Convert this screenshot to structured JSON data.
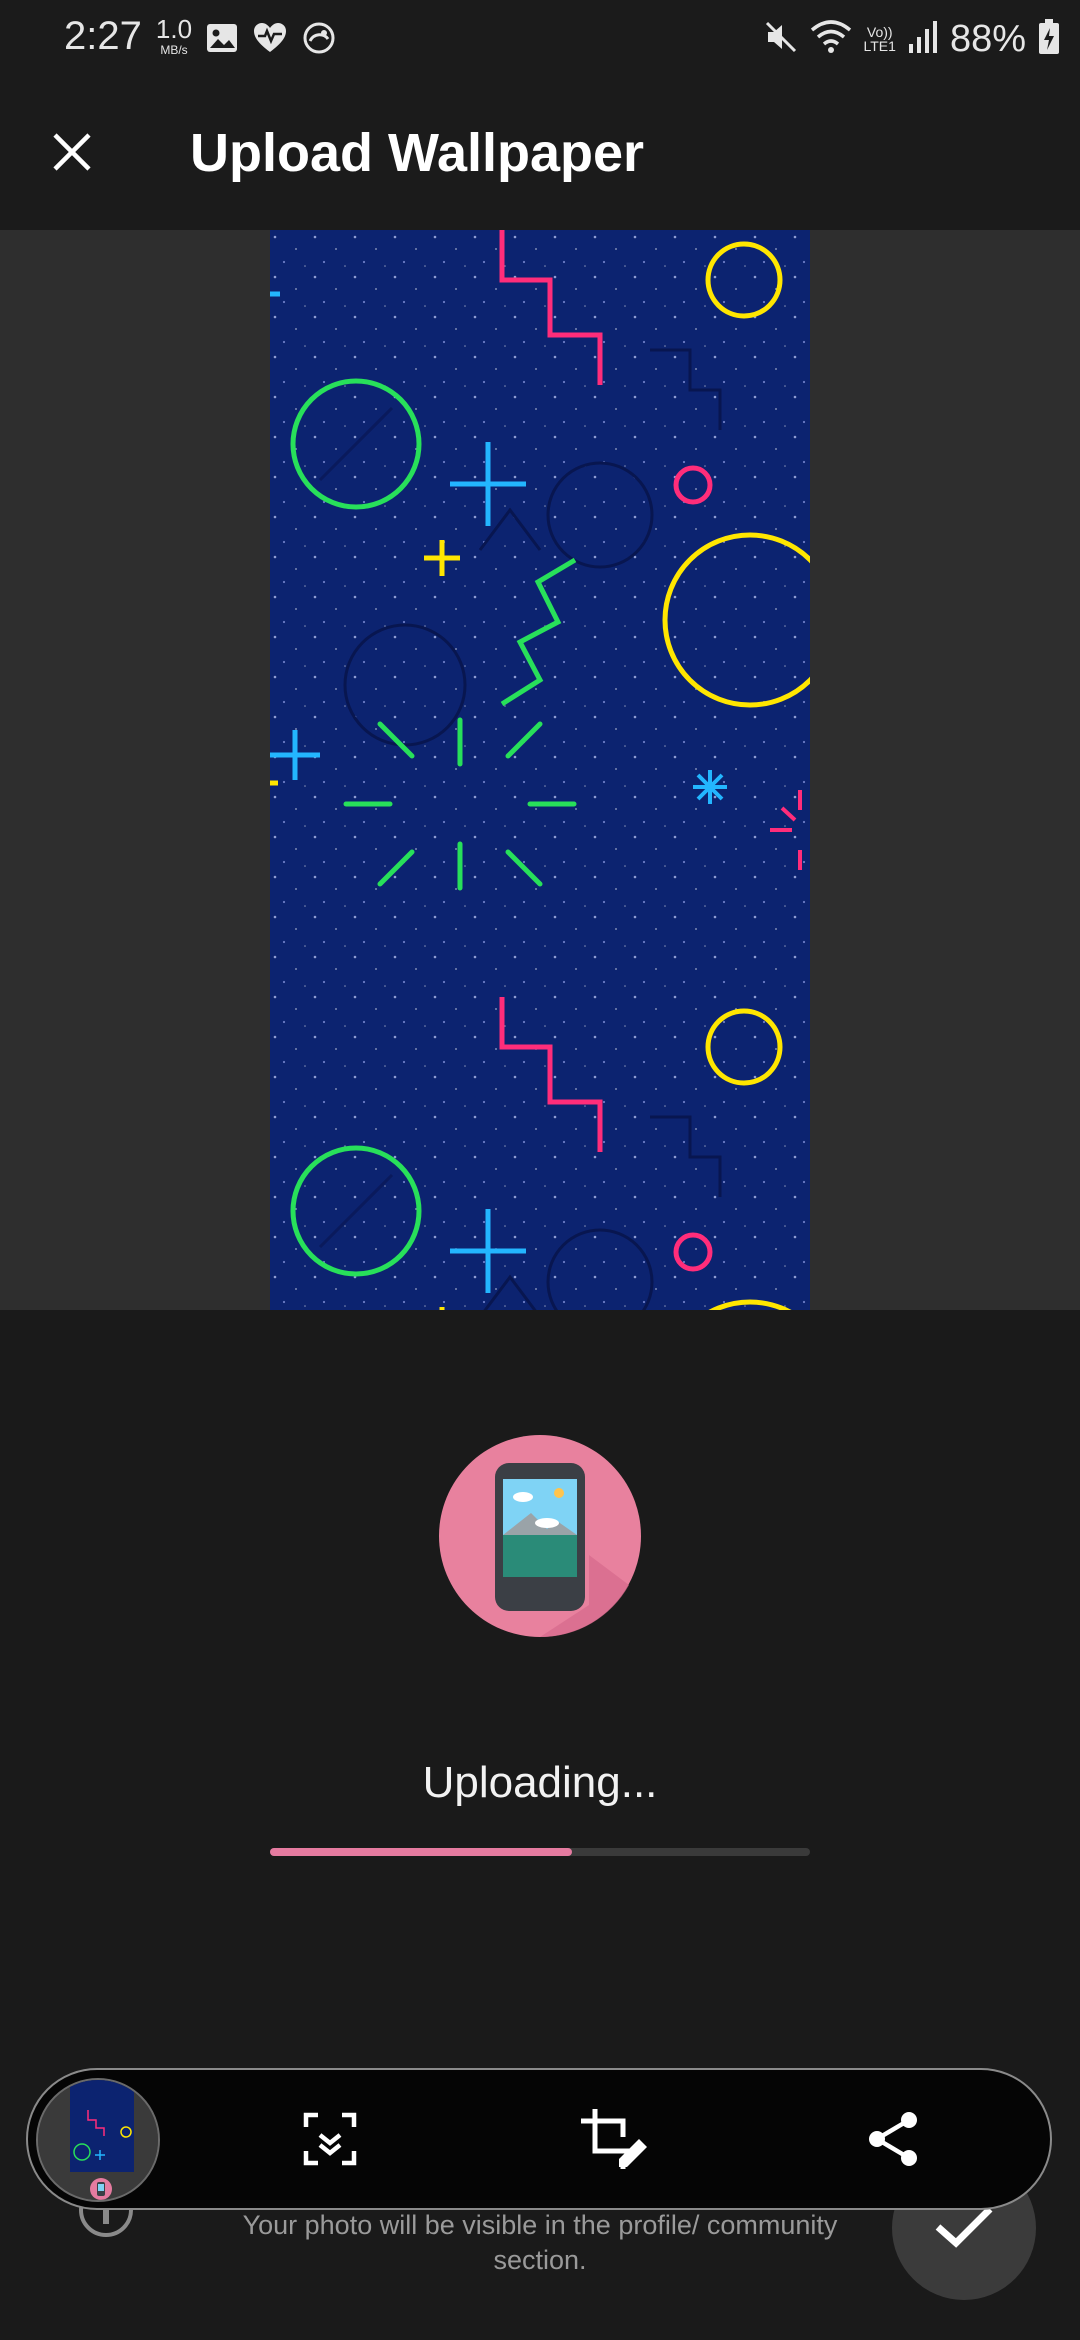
{
  "status_bar": {
    "time": "2:27",
    "net_speed_value": "1.0",
    "net_speed_unit": "MB/s",
    "network_label_top": "Vo))",
    "network_label_bottom": "LTE1",
    "battery": "88%"
  },
  "app_bar": {
    "title": "Upload Wallpaper",
    "close_icon": "close-icon"
  },
  "upload": {
    "status_text": "Uploading...",
    "progress": 0.56,
    "icon": "phone-wallpaper-icon"
  },
  "footer": {
    "note": "Your photo will be visible in the profile/ community section."
  },
  "toolbar": {
    "thumbnail_icon": "wallpaper-thumbnail",
    "actions": [
      {
        "name": "fit-screen-icon"
      },
      {
        "name": "crop-edit-icon"
      },
      {
        "name": "share-icon"
      }
    ]
  },
  "colors": {
    "background": "#1a1a1a",
    "accent_pink": "#e57ba0",
    "wallpaper_blue": "#0c2370"
  }
}
